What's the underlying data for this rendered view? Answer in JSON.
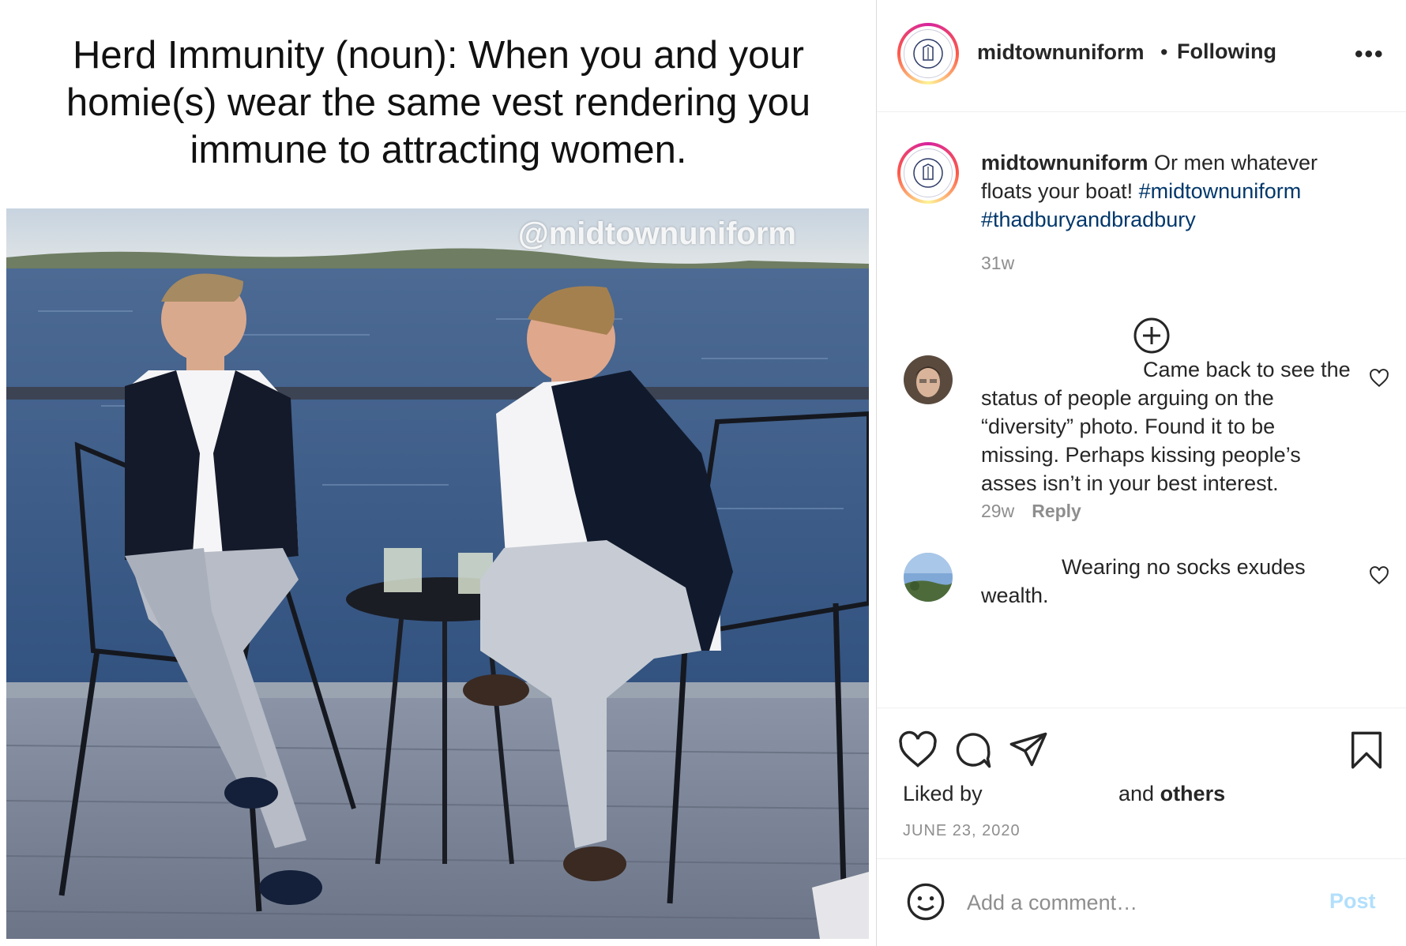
{
  "meme": {
    "caption": "Herd Immunity (noun): When you and your homie(s) wear the same vest rendering you immune to attracting women.",
    "watermark": "@midtownuniform"
  },
  "header": {
    "username": "midtownuniform",
    "separator": "•",
    "follow_status": "Following",
    "more": "•••"
  },
  "caption": {
    "username": "midtownuniform",
    "text": " Or men whatever floats your boat! ",
    "hashtags": [
      "#midtownuniform",
      "#thadburyandbradbury"
    ],
    "time": "31w"
  },
  "comments": [
    {
      "text": "Came back to see the status of people arguing on the “diversity” photo. Found it to be missing. Perhaps kissing people’s asses isn’t in your best interest.",
      "time": "29w",
      "reply_label": "Reply"
    },
    {
      "text": "Wearing no socks exudes wealth."
    }
  ],
  "likes": {
    "liked_by": "Liked by",
    "and": "and",
    "others": "others"
  },
  "date": "JUNE 23, 2020",
  "add_comment": {
    "placeholder": "Add a comment…",
    "post_label": "Post"
  },
  "colors": {
    "hashtag": "#00376b",
    "post_button_disabled": "#b2dffc",
    "muted": "#8e8e8e"
  }
}
